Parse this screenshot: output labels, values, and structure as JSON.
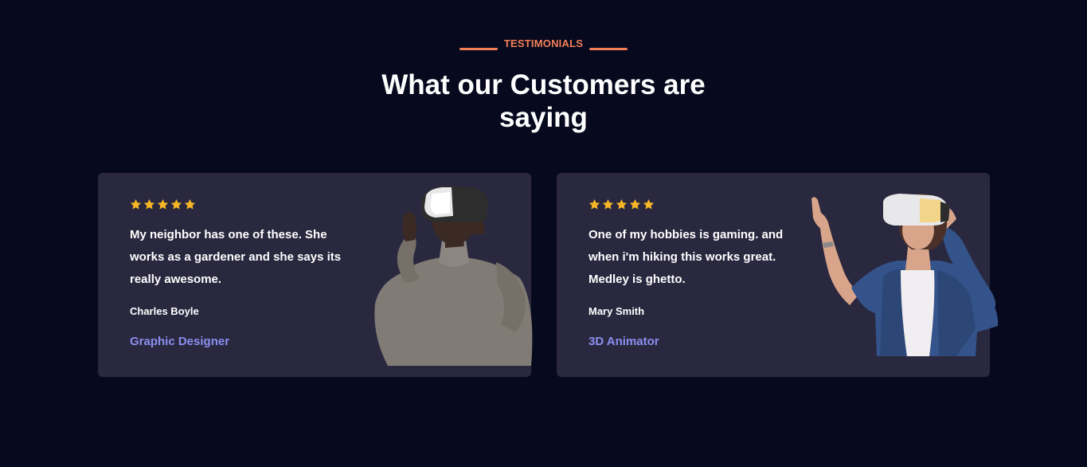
{
  "section": {
    "eyebrow": "TESTIMONIALS",
    "heading_line1": "What our Customers are",
    "heading_line2": "saying"
  },
  "testimonials": [
    {
      "rating": 5,
      "quote": "My neighbor has one of these. She works as a gardener and she says its really awesome.",
      "name": "Charles Boyle",
      "role": "Graphic Designer",
      "photo_icon": "man-with-vr-headset"
    },
    {
      "rating": 5,
      "quote": "One of my hobbies is gaming. and when i'm hiking this works great. Medley is ghetto.",
      "name": "Mary Smith",
      "role": "3D Animator",
      "photo_icon": "woman-with-vr-headset"
    }
  ],
  "colors": {
    "background": "#070a1e",
    "card": "#29283f",
    "accent": "#f27f57",
    "star": "#f7b625",
    "role": "#8c8ff0"
  }
}
